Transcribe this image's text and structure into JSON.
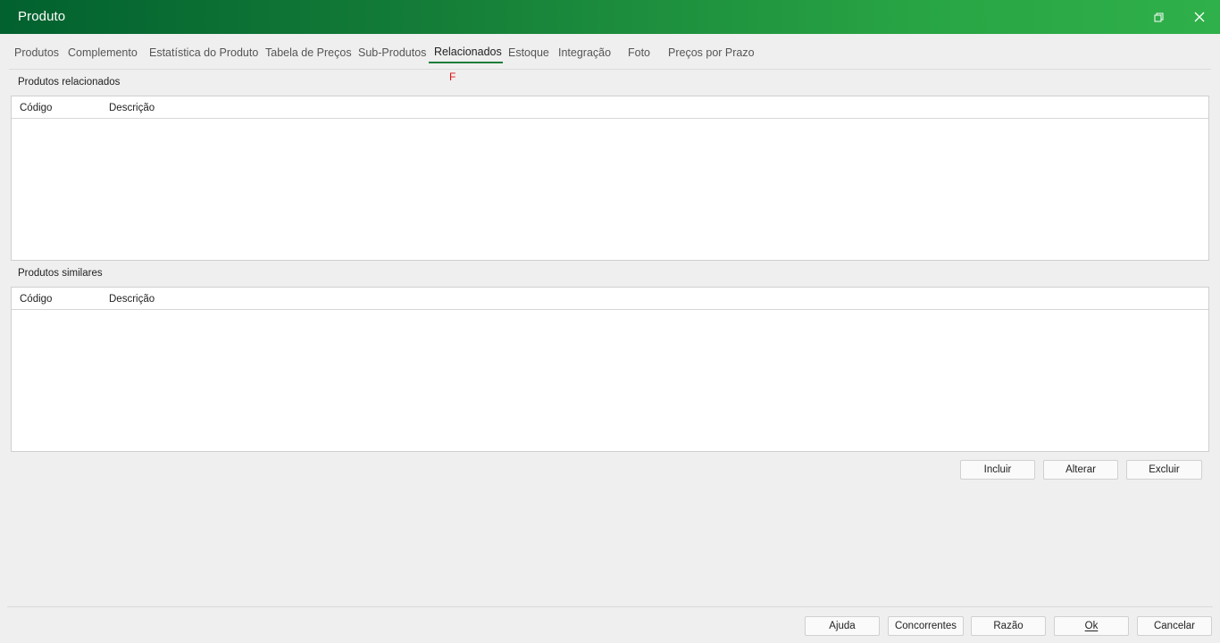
{
  "window": {
    "title": "Produto"
  },
  "tabs": [
    {
      "label": "Produtos"
    },
    {
      "label": "Complemento"
    },
    {
      "label": "Estatística do Produto"
    },
    {
      "label": "Tabela de Preços"
    },
    {
      "label": "Sub-Produtos"
    },
    {
      "label": "Relacionados",
      "active": true
    },
    {
      "label": "Estoque"
    },
    {
      "label": "Integração"
    },
    {
      "label": "Foto"
    },
    {
      "label": "Preços por Prazo"
    }
  ],
  "shortcut_hint": "F",
  "related": {
    "title": "Produtos relacionados",
    "columns": [
      "Código",
      "Descrição"
    ],
    "rows": []
  },
  "similar": {
    "title": "Produtos similares",
    "columns": [
      "Código",
      "Descrição"
    ],
    "rows": []
  },
  "actions": {
    "include": "Incluir",
    "alter": "Alterar",
    "delete": "Excluir"
  },
  "footer": {
    "help": "Ajuda",
    "competitors": "Concorrentes",
    "ratio": "Razão",
    "ok": "Ok",
    "cancel": "Cancelar"
  },
  "colors": {
    "title_gradient_start": "#02612f",
    "title_gradient_end": "#2fb04a",
    "tab_underline": "#1e7d3a",
    "shortcut_hint": "#e01010"
  }
}
